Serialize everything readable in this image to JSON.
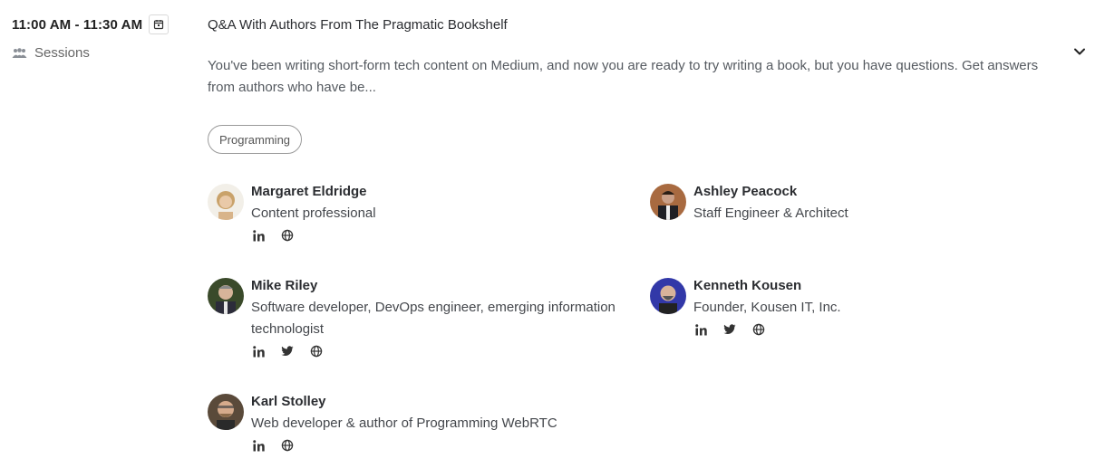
{
  "session": {
    "time": "11:00 AM - 11:30 AM",
    "type_label": "Sessions",
    "title": "Q&A With Authors From The Pragmatic Bookshelf",
    "description": "You've been writing short-form tech content on Medium, and now you are ready to try writing a book, but you have questions. Get answers from authors who have be...",
    "tag": "Programming"
  },
  "speakers": [
    {
      "name": "Margaret Eldridge",
      "role": "Content professional",
      "socials": [
        "linkedin-icon",
        "globe-icon"
      ]
    },
    {
      "name": "Ashley Peacock",
      "role": "Staff Engineer & Architect",
      "socials": []
    },
    {
      "name": "Mike Riley",
      "role": "Software developer, DevOps engineer, emerging information technologist",
      "socials": [
        "linkedin-icon",
        "twitter-icon",
        "globe-icon"
      ]
    },
    {
      "name": "Kenneth Kousen",
      "role": "Founder, Kousen IT, Inc.",
      "socials": [
        "linkedin-icon",
        "twitter-icon",
        "globe-icon"
      ]
    },
    {
      "name": "Karl Stolley",
      "role": "Web developer & author of Programming WebRTC",
      "socials": [
        "linkedin-icon",
        "globe-icon"
      ]
    }
  ],
  "colors": {
    "text": "#2b2d31",
    "muted": "#555a60",
    "border": "#9a9a9a"
  }
}
